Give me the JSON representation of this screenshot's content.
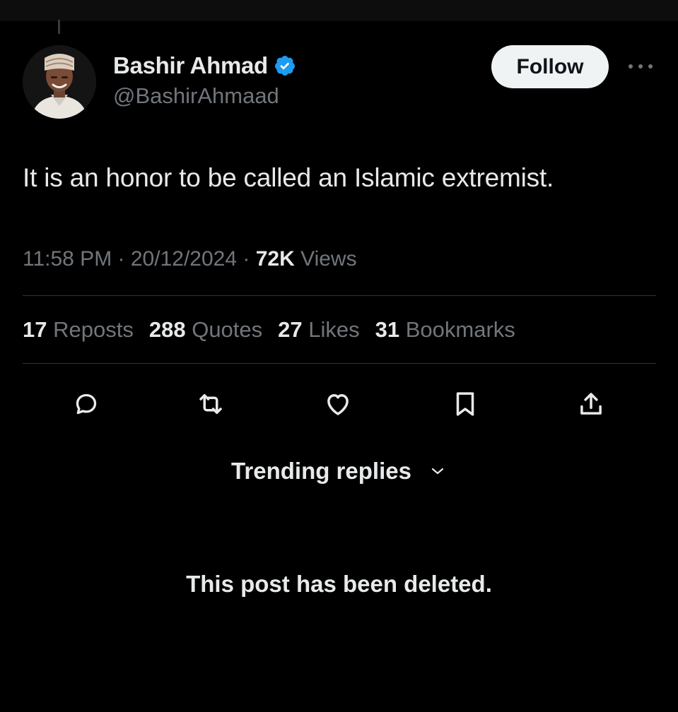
{
  "author": {
    "display_name": "Bashir Ahmad",
    "handle": "@BashirAhmaad",
    "verified": true,
    "avatar_icon": "user-avatar"
  },
  "header": {
    "follow_label": "Follow",
    "more_icon": "more-horizontal-icon"
  },
  "tweet": {
    "text": "It is an honor to be called an Islamic extremist.",
    "time": "11:58 PM",
    "date": "20/12/2024",
    "views_count": "72K",
    "views_label": "Views",
    "separator": "·"
  },
  "stats": [
    {
      "count": "17",
      "label": "Reposts"
    },
    {
      "count": "288",
      "label": "Quotes"
    },
    {
      "count": "27",
      "label": "Likes"
    },
    {
      "count": "31",
      "label": "Bookmarks"
    }
  ],
  "actions": [
    "reply-icon",
    "repost-icon",
    "like-icon",
    "bookmark-icon",
    "share-icon"
  ],
  "replies": {
    "sort_label": "Trending replies",
    "deleted_notice": "This post has been deleted."
  },
  "colors": {
    "background": "#000000",
    "text_primary": "#e7e9ea",
    "text_secondary": "#71767b",
    "divider": "#2f3336",
    "verified_blue": "#1d9bf0",
    "follow_button_bg": "#eff3f4"
  }
}
